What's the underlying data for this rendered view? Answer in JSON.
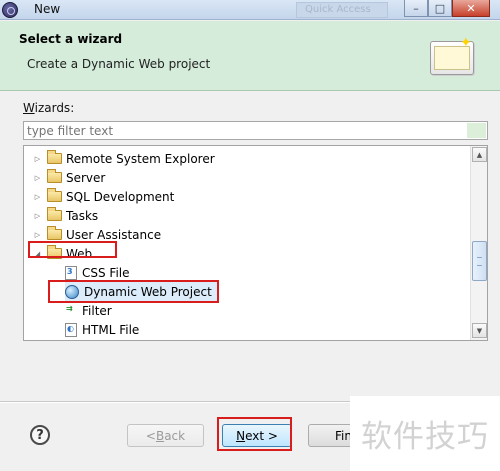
{
  "window": {
    "title": "New",
    "background_tab": "Quick Access",
    "buttons": {
      "minimize": "–",
      "maximize": "□",
      "close": "✕"
    }
  },
  "banner": {
    "title": "Select a wizard",
    "description": "Create a Dynamic Web project",
    "icon": "wizard-banner-icon"
  },
  "filter": {
    "label_mnemonic": "W",
    "label_rest": "izards:",
    "placeholder": "type filter text"
  },
  "tree": {
    "items": [
      {
        "label": "Remote System Explorer",
        "icon": "folder-icon",
        "expander": "▷"
      },
      {
        "label": "Server",
        "icon": "folder-icon",
        "expander": "▷"
      },
      {
        "label": "SQL Development",
        "icon": "folder-icon",
        "expander": "▷"
      },
      {
        "label": "Tasks",
        "icon": "folder-icon",
        "expander": "▷"
      },
      {
        "label": "User Assistance",
        "icon": "folder-icon",
        "expander": "▷"
      },
      {
        "label": "Web",
        "icon": "open-folder-icon",
        "expander": "◢",
        "expanded": true
      },
      {
        "label": "CSS File",
        "icon": "css-file-icon",
        "child": true
      },
      {
        "label": "Dynamic Web Project",
        "icon": "web-project-icon",
        "child": true,
        "selected": true
      },
      {
        "label": "Filter",
        "icon": "filter-icon",
        "child": true
      },
      {
        "label": "HTML File",
        "icon": "html-file-icon",
        "child": true
      }
    ],
    "scroll_up": "▲",
    "scroll_down": "▼"
  },
  "footer": {
    "help": "?",
    "back_prefix": "< ",
    "back_mnemonic": "B",
    "back_rest": "ack",
    "next_mnemonic": "N",
    "next_rest": "ext >",
    "finish_partial": "Fin"
  },
  "watermark": "软件技巧",
  "colors": {
    "banner_bg": "#d4ecd9",
    "highlight_box": "#d91c1c",
    "selection_bg": "#dcecfb"
  }
}
